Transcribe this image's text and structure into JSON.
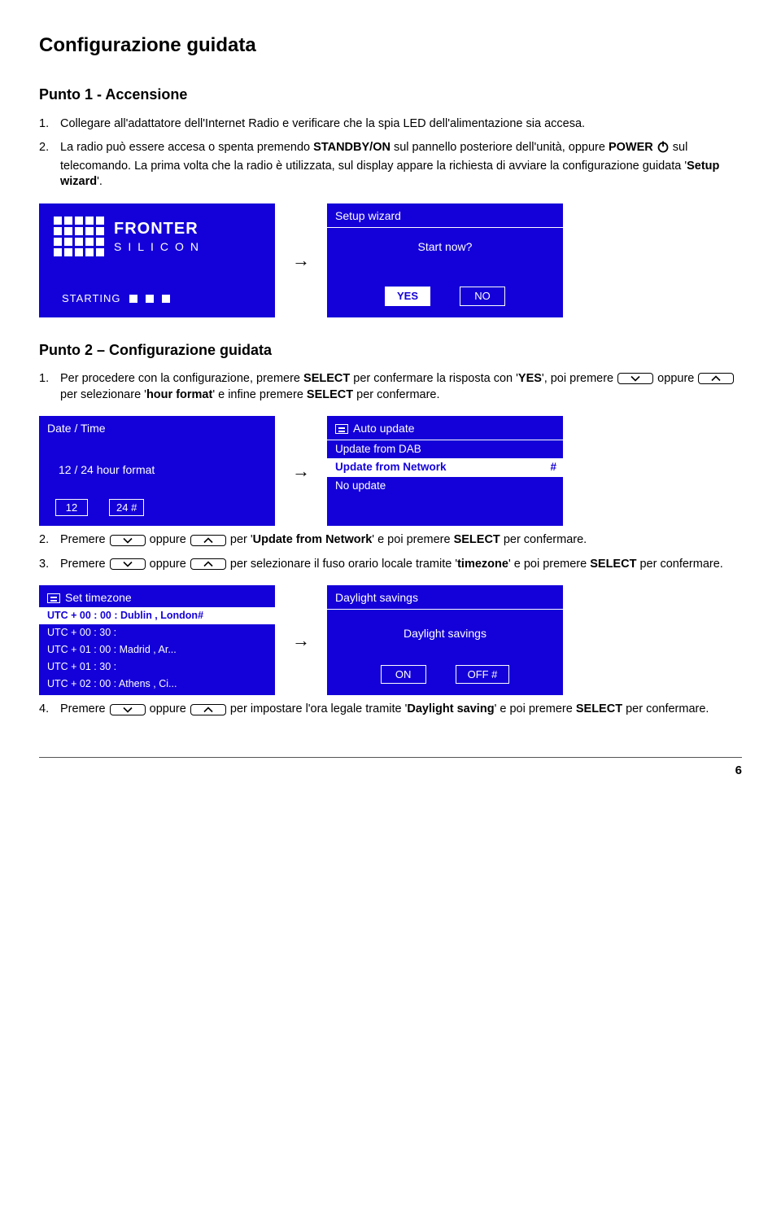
{
  "title": "Configurazione guidata",
  "section1": {
    "heading": "Punto 1 - Accensione",
    "item1": "Collegare all'adattatore dell'Internet Radio e verificare che la spia LED dell'alimentazione sia accesa.",
    "item2a": "La radio può essere accesa o spenta premendo ",
    "item2b": "STANDBY/ON",
    "item2c": " sul pannello posteriore dell'unità, oppure ",
    "item2d": "POWER",
    "item2e": " sul telecomando. La prima volta che la radio è utilizzata, sul display appare la richiesta di avviare la configurazione guidata '",
    "item2f": "Setup wizard",
    "item2g": "'."
  },
  "screenA1": {
    "logo": "FRONTER",
    "sub": "SILICON",
    "starting": "STARTING"
  },
  "screenA2": {
    "title": "Setup wizard",
    "prompt": "Start now?",
    "yes": "YES",
    "no": "NO"
  },
  "section2": {
    "heading": "Punto 2 – Configurazione guidata",
    "item1a": "Per procedere con la configurazione, premere ",
    "item1b": "SELECT",
    "item1c": " per confermare la risposta con '",
    "item1d": "YES",
    "item1e": "', poi premere ",
    "item1f": " oppure ",
    "item1g": " per selezionare '",
    "item1h": "hour format",
    "item1i": "' e infine premere ",
    "item1j": "SELECT",
    "item1k": " per confermare."
  },
  "screenB1": {
    "title": "Date / Time",
    "line": "12 / 24  hour  format",
    "opt1": "12",
    "opt2": "24 #"
  },
  "screenB2": {
    "title": "Auto update",
    "m1": "Update from DAB",
    "m2": "Update from Network",
    "m3": "No update"
  },
  "step2": {
    "a": "Premere ",
    "b": " oppure ",
    "c": " per '",
    "d": "Update from Network",
    "e": "' e poi premere ",
    "f": "SELECT",
    "g": " per confermare."
  },
  "step3": {
    "a": "Premere ",
    "b": " oppure ",
    "c": " per selezionare il fuso orario locale tramite '",
    "d": "timezone",
    "e": "' e poi premere ",
    "f": "SELECT",
    "g": " per confermare."
  },
  "screenC1": {
    "title": "Set timezone",
    "rows": [
      "UTC + 00 : 00 : Dublin , London#",
      "UTC + 00 : 30 :",
      "UTC + 01 : 00 : Madrid , Ar...",
      "UTC + 01 : 30 :",
      "UTC + 02 : 00 : Athens , Ci..."
    ]
  },
  "screenC2": {
    "title": "Daylight savings",
    "prompt": "Daylight savings",
    "on": "ON",
    "off": "OFF #"
  },
  "step4": {
    "a": "Premere ",
    "b": " oppure ",
    "c": " per impostare l'ora legale tramite '",
    "d": "Daylight saving",
    "e": "' e poi premere ",
    "f": "SELECT",
    "g": " per confermare."
  },
  "page": "6"
}
